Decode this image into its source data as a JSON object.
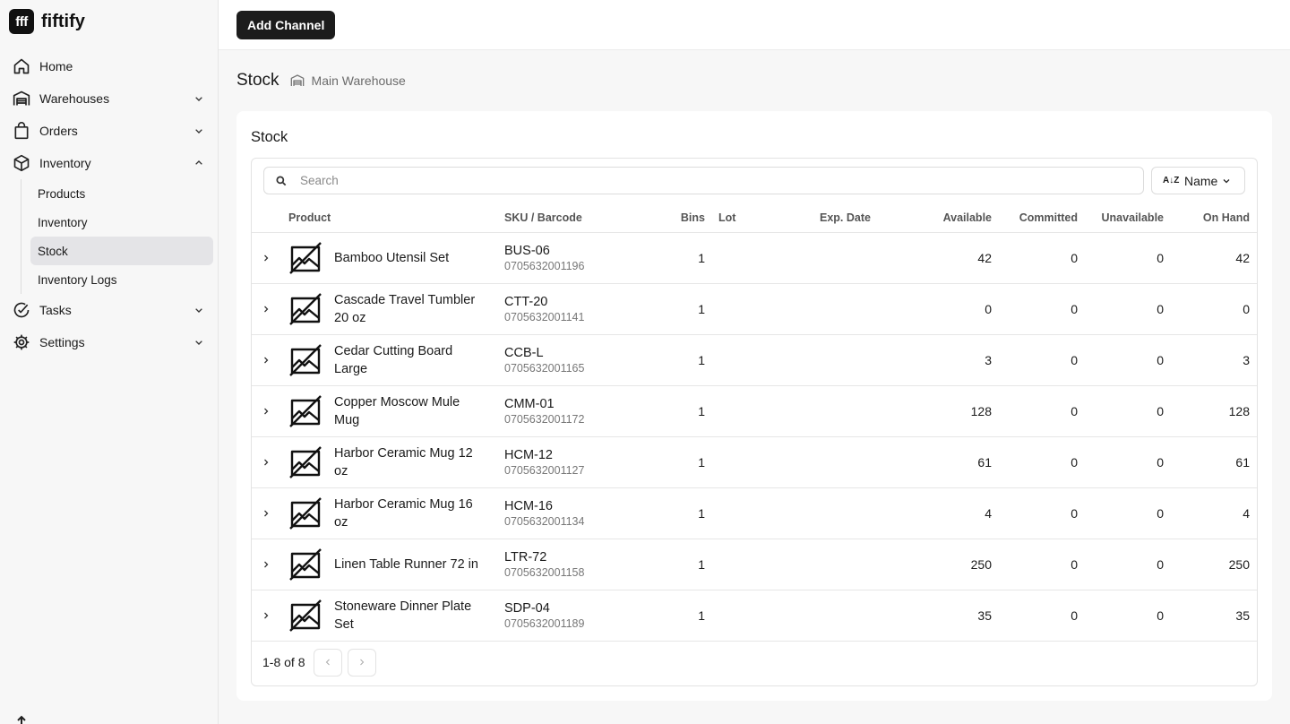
{
  "app": {
    "logo_text": "fff",
    "name": "fiftify"
  },
  "sidebar": {
    "items": [
      {
        "label": "Home",
        "icon": "home-icon"
      },
      {
        "label": "Warehouses",
        "icon": "warehouse-icon"
      },
      {
        "label": "Orders",
        "icon": "shopping-bag-icon"
      },
      {
        "label": "Inventory",
        "icon": "box-icon",
        "expanded": true
      },
      {
        "label": "Tasks",
        "icon": "check-circle-icon"
      },
      {
        "label": "Settings",
        "icon": "gear-icon"
      }
    ],
    "inventory_sub": [
      {
        "label": "Products"
      },
      {
        "label": "Inventory"
      },
      {
        "label": "Stock",
        "active": true
      },
      {
        "label": "Inventory Logs"
      }
    ]
  },
  "topbar": {
    "add_channel": "Add Channel"
  },
  "header": {
    "title": "Stock",
    "warehouse": "Main Warehouse"
  },
  "card": {
    "title": "Stock",
    "search_placeholder": "Search",
    "sort_label": "Name",
    "sort_icon": "A↓Z"
  },
  "table": {
    "headers": {
      "product": "Product",
      "sku": "SKU / Barcode",
      "bins": "Bins",
      "lot": "Lot",
      "exp": "Exp. Date",
      "available": "Available",
      "committed": "Committed",
      "unavailable": "Unavailable",
      "on_hand": "On Hand"
    },
    "rows": [
      {
        "name": "Bamboo Utensil Set",
        "sku": "BUS-06",
        "barcode": "0705632001196",
        "bins": "1",
        "lot": "",
        "exp": "",
        "available": "42",
        "committed": "0",
        "unavailable": "0",
        "on_hand": "42"
      },
      {
        "name": "Cascade Travel Tumbler 20 oz",
        "sku": "CTT-20",
        "barcode": "0705632001141",
        "bins": "1",
        "lot": "",
        "exp": "",
        "available": "0",
        "committed": "0",
        "unavailable": "0",
        "on_hand": "0"
      },
      {
        "name": "Cedar Cutting Board Large",
        "sku": "CCB-L",
        "barcode": "0705632001165",
        "bins": "1",
        "lot": "",
        "exp": "",
        "available": "3",
        "committed": "0",
        "unavailable": "0",
        "on_hand": "3"
      },
      {
        "name": "Copper Moscow Mule Mug",
        "sku": "CMM-01",
        "barcode": "0705632001172",
        "bins": "1",
        "lot": "",
        "exp": "",
        "available": "128",
        "committed": "0",
        "unavailable": "0",
        "on_hand": "128"
      },
      {
        "name": "Harbor Ceramic Mug 12 oz",
        "sku": "HCM-12",
        "barcode": "0705632001127",
        "bins": "1",
        "lot": "",
        "exp": "",
        "available": "61",
        "committed": "0",
        "unavailable": "0",
        "on_hand": "61"
      },
      {
        "name": "Harbor Ceramic Mug 16 oz",
        "sku": "HCM-16",
        "barcode": "0705632001134",
        "bins": "1",
        "lot": "",
        "exp": "",
        "available": "4",
        "committed": "0",
        "unavailable": "0",
        "on_hand": "4"
      },
      {
        "name": "Linen Table Runner 72 in",
        "sku": "LTR-72",
        "barcode": "0705632001158",
        "bins": "1",
        "lot": "",
        "exp": "",
        "available": "250",
        "committed": "0",
        "unavailable": "0",
        "on_hand": "250"
      },
      {
        "name": "Stoneware Dinner Plate Set",
        "sku": "SDP-04",
        "barcode": "0705632001189",
        "bins": "1",
        "lot": "",
        "exp": "",
        "available": "35",
        "committed": "0",
        "unavailable": "0",
        "on_hand": "35"
      }
    ]
  },
  "pagination": {
    "text": "1-8 of 8"
  }
}
